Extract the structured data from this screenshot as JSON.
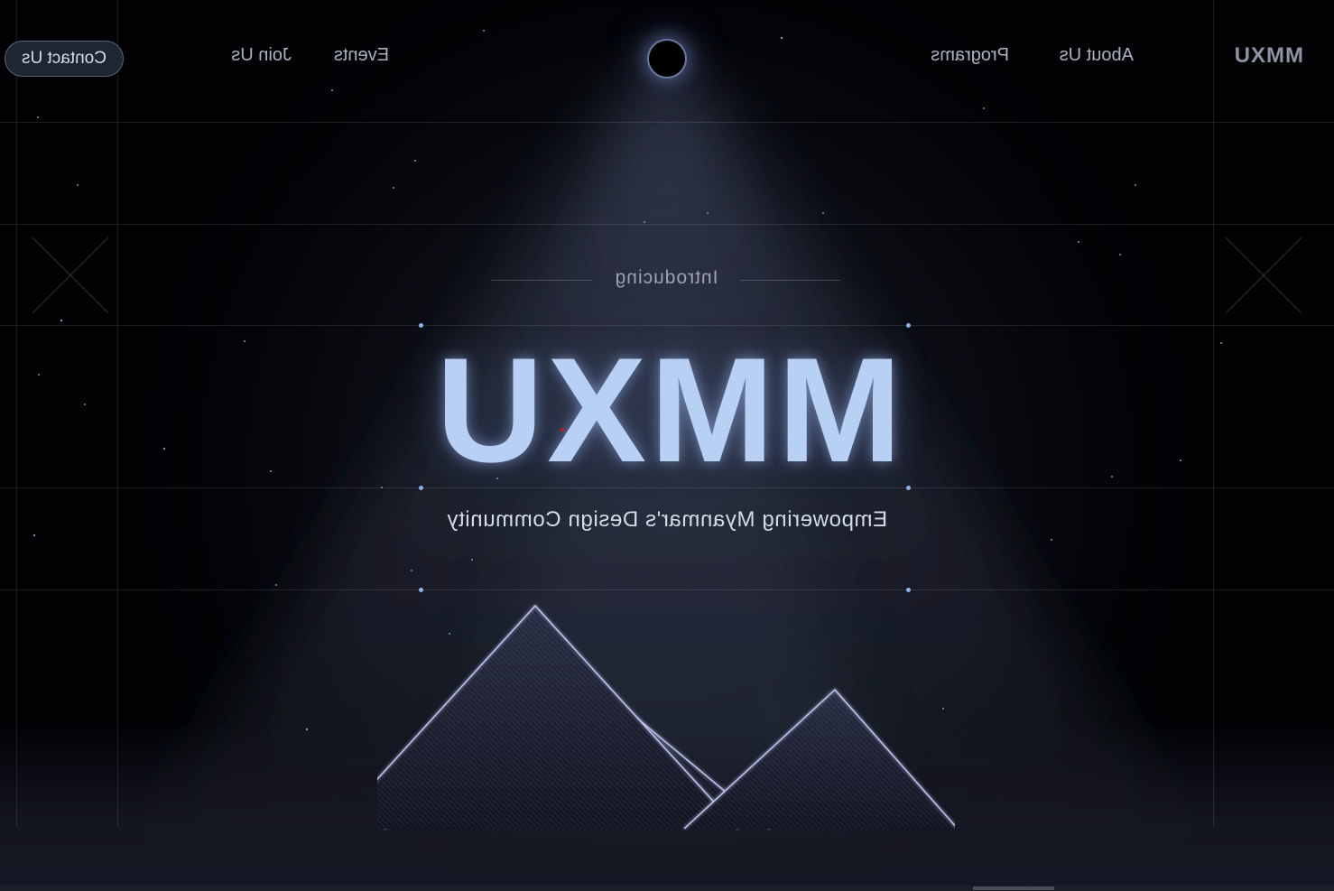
{
  "header": {
    "logo": "MMXU",
    "nav": [
      {
        "label": "About Us"
      },
      {
        "label": "Programs"
      },
      {
        "label": "Events"
      },
      {
        "label": "Join Us"
      }
    ],
    "contact_label": "Contact Us"
  },
  "hero": {
    "eyebrow": "Introducing",
    "title": "MMXU",
    "tagline": "Empowering Myanmar's Design Community"
  },
  "theme": {
    "background": "#020205",
    "title_color": "#b8d0f4",
    "accent_glow": "#8fb0e6",
    "mountain_stroke": "#aeb4e8"
  },
  "icons": [
    "eclipse-icon",
    "x-mark-icon",
    "mountains-illustration"
  ]
}
